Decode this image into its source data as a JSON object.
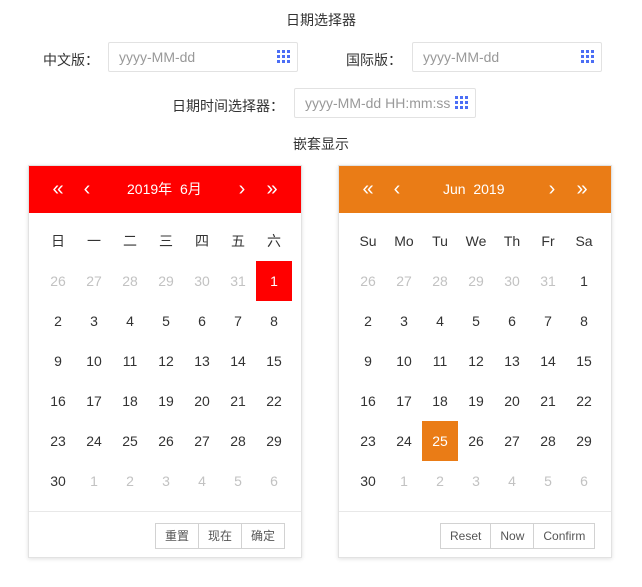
{
  "page_title": "日期选择器",
  "nested_title": "嵌套显示",
  "fields": {
    "cn": {
      "label": "中文版：",
      "placeholder": "yyyy-MM-dd"
    },
    "intl": {
      "label": "国际版：",
      "placeholder": "yyyy-MM-dd"
    },
    "datetime": {
      "label": "日期时间选择器：",
      "placeholder": "yyyy-MM-dd HH:mm:ss"
    }
  },
  "colors": {
    "red_theme": "#ff0000",
    "orange_theme": "#ea7c16",
    "icon_blue": "#4c6ef5"
  },
  "icons": {
    "prev_year": "«",
    "prev_month": "‹",
    "next_month": "›",
    "next_year": "»"
  },
  "calendar_cn": {
    "year_label": "2019年",
    "month_label": "6月",
    "weekdays": [
      "日",
      "一",
      "二",
      "三",
      "四",
      "五",
      "六"
    ],
    "days": [
      [
        "26",
        "27",
        "28",
        "29",
        "30",
        "31",
        "1"
      ],
      [
        "2",
        "3",
        "4",
        "5",
        "6",
        "7",
        "8"
      ],
      [
        "9",
        "10",
        "11",
        "12",
        "13",
        "14",
        "15"
      ],
      [
        "16",
        "17",
        "18",
        "19",
        "20",
        "21",
        "22"
      ],
      [
        "23",
        "24",
        "25",
        "26",
        "27",
        "28",
        "29"
      ],
      [
        "30",
        "1",
        "2",
        "3",
        "4",
        "5",
        "6"
      ]
    ],
    "selected_day": "1",
    "buttons": {
      "reset": "重置",
      "now": "现在",
      "confirm": "确定"
    }
  },
  "calendar_intl": {
    "month_label": "Jun",
    "year_label": "2019",
    "weekdays": [
      "Su",
      "Mo",
      "Tu",
      "We",
      "Th",
      "Fr",
      "Sa"
    ],
    "days": [
      [
        "26",
        "27",
        "28",
        "29",
        "30",
        "31",
        "1"
      ],
      [
        "2",
        "3",
        "4",
        "5",
        "6",
        "7",
        "8"
      ],
      [
        "9",
        "10",
        "11",
        "12",
        "13",
        "14",
        "15"
      ],
      [
        "16",
        "17",
        "18",
        "19",
        "20",
        "21",
        "22"
      ],
      [
        "23",
        "24",
        "25",
        "26",
        "27",
        "28",
        "29"
      ],
      [
        "30",
        "1",
        "2",
        "3",
        "4",
        "5",
        "6"
      ]
    ],
    "selected_day": "25",
    "buttons": {
      "reset": "Reset",
      "now": "Now",
      "confirm": "Confirm"
    }
  }
}
